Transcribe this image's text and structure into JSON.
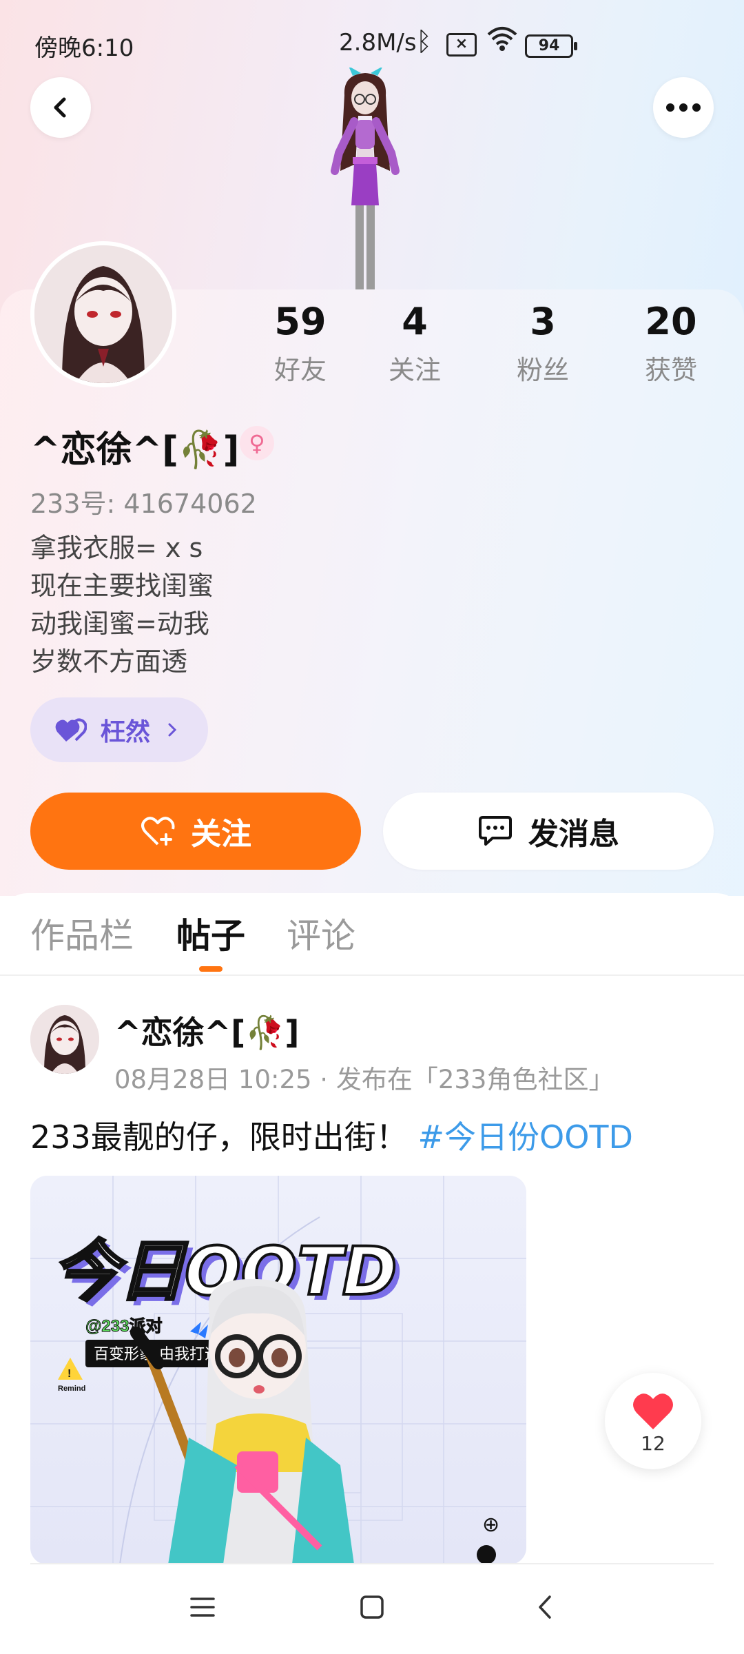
{
  "status_bar": {
    "time": "傍晚6:10",
    "net_speed": "2.8M/s",
    "battery": "94"
  },
  "header": {
    "back_icon": "chevron-left-icon",
    "more_icon": "ellipsis-icon"
  },
  "stats": [
    {
      "value": "59",
      "label": "好友"
    },
    {
      "value": "4",
      "label": "关注"
    },
    {
      "value": "3",
      "label": "粉丝"
    },
    {
      "value": "20",
      "label": "获赞"
    }
  ],
  "profile": {
    "nickname": "^恋徐^[🥀]",
    "gender_icon": "♀",
    "uid": "233号: 41674062",
    "bio": [
      "拿我衣服= x s",
      "现在主要找闺蜜",
      "动我闺蜜=动我",
      "岁数不方面透"
    ],
    "tag_label": "枉然"
  },
  "actions": {
    "follow_label": "关注",
    "message_label": "发消息",
    "follow_color": "#ff7411"
  },
  "tabs": [
    {
      "label": "作品栏",
      "active": false
    },
    {
      "label": "帖子",
      "active": true
    },
    {
      "label": "评论",
      "active": false
    }
  ],
  "post": {
    "author": "^恋徐^[🥀]",
    "meta": "08月28日 10:25 · 发布在「233角色社区」",
    "text": "233最靓的仔，限时出街！",
    "hashtag": "#今日份OOTD",
    "image": {
      "title": "今日OOTD",
      "sub_tag": "@233派对",
      "banner": "百变形象 由我打造!",
      "remind": "Remind"
    },
    "likes": "12"
  }
}
